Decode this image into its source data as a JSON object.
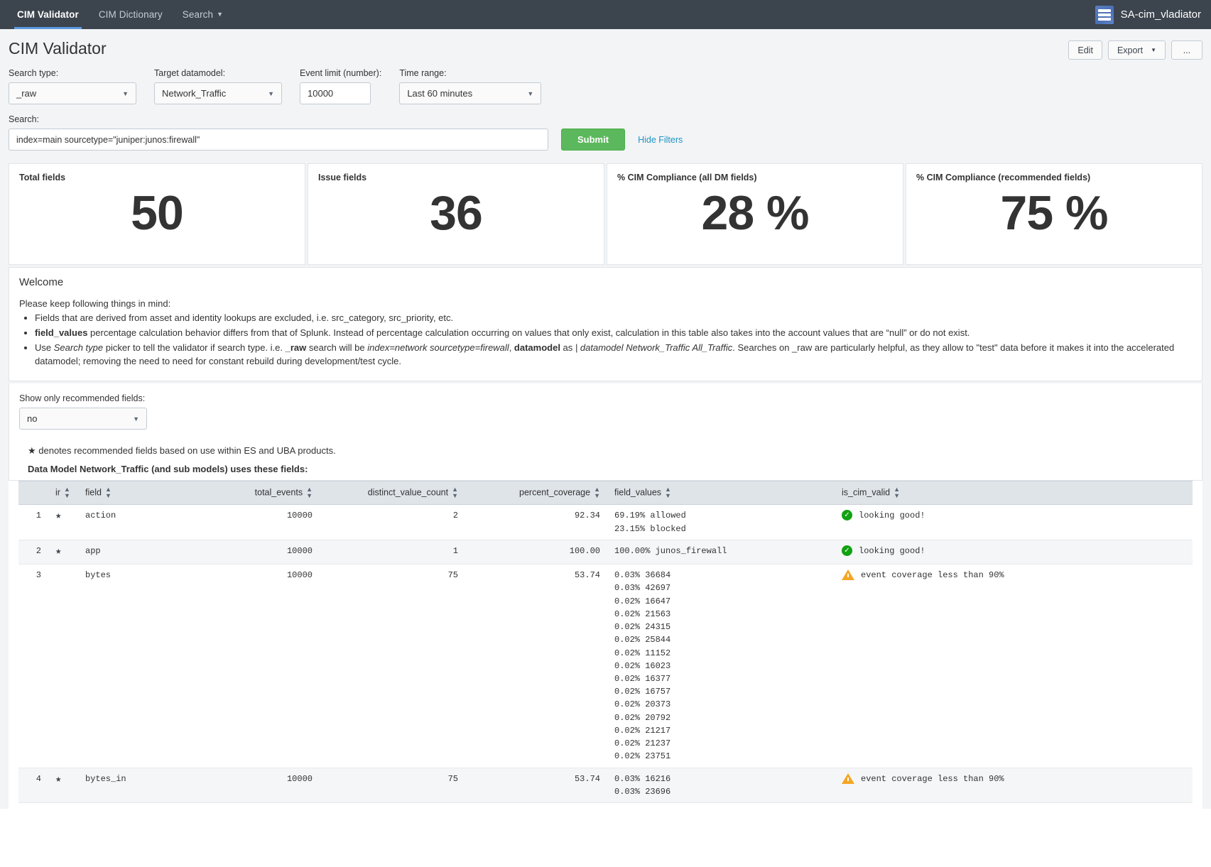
{
  "appbar": {
    "nav": [
      {
        "label": "CIM Validator",
        "active": true,
        "caret": false
      },
      {
        "label": "CIM Dictionary",
        "active": false,
        "caret": false
      },
      {
        "label": "Search",
        "active": false,
        "caret": true
      }
    ],
    "app_name": "SA-cim_vladiator",
    "logo_icon": "app-logo-icon"
  },
  "header": {
    "title": "CIM Validator",
    "edit_label": "Edit",
    "export_label": "Export",
    "more_label": "..."
  },
  "filters": {
    "search_type": {
      "label": "Search type:",
      "value": "_raw"
    },
    "target_datamodel": {
      "label": "Target datamodel:",
      "value": "Network_Traffic"
    },
    "event_limit": {
      "label": "Event limit (number):",
      "value": "10000"
    },
    "time_range": {
      "label": "Time range:",
      "value": "Last 60 minutes"
    }
  },
  "search": {
    "label": "Search:",
    "value": "index=main sourcetype=\"juniper:junos:firewall\"",
    "submit_label": "Submit",
    "hide_filters_label": "Hide Filters"
  },
  "kpis": [
    {
      "title": "Total fields",
      "value": "50"
    },
    {
      "title": "Issue fields",
      "value": "36"
    },
    {
      "title": "% CIM Compliance (all DM fields)",
      "value": "28 %"
    },
    {
      "title": "% CIM Compliance (recommended fields)",
      "value": "75 %"
    }
  ],
  "welcome": {
    "heading": "Welcome",
    "intro": "Please keep following things in mind:",
    "bullet1": "Fields that are derived from asset and identity lookups are excluded, i.e. src_category, src_priority, etc.",
    "bullet2_bold": "field_values",
    "bullet2_rest": " percentage calculation behavior differs from that of Splunk. Instead of percentage calculation occurring on values that only exist, calculation in this table also takes into the account values that are “null” or do not exist.",
    "bullet3_a": "Use ",
    "bullet3_i1": "Search type",
    "bullet3_b": " picker to tell the validator if search type. i.e. ",
    "bullet3_bold1": "_raw",
    "bullet3_c": " search will be ",
    "bullet3_i2": "index=network sourcetype=firewall",
    "bullet3_d": ", ",
    "bullet3_bold2": "datamodel",
    "bullet3_e": " as ",
    "bullet3_i3": "| datamodel Network_Traffic All_Traffic",
    "bullet3_f": ". Searches on _raw are particularly helpful, as they allow to \"test\" data before it makes it into the accelerated datamodel; removing the need to need for constant rebuild during development/test cycle."
  },
  "recommended_filter": {
    "label": "Show only recommended fields:",
    "value": "no"
  },
  "star_note": "★ denotes recommended fields based on use within ES and UBA products.",
  "table_title": "Data Model Network_Traffic (and sub models) uses these fields:",
  "table": {
    "columns": [
      {
        "key": "idx",
        "label": "",
        "align": "left",
        "sortable": false
      },
      {
        "key": "ir",
        "label": "ir",
        "align": "left",
        "sortable": true
      },
      {
        "key": "field",
        "label": "field",
        "align": "left",
        "sortable": true
      },
      {
        "key": "total_events",
        "label": "total_events",
        "align": "right",
        "sortable": true
      },
      {
        "key": "distinct_value_count",
        "label": "distinct_value_count",
        "align": "right",
        "sortable": true
      },
      {
        "key": "percent_coverage",
        "label": "percent_coverage",
        "align": "right",
        "sortable": true
      },
      {
        "key": "field_values",
        "label": "field_values",
        "align": "left",
        "sortable": true
      },
      {
        "key": "is_cim_valid",
        "label": "is_cim_valid",
        "align": "left",
        "sortable": true
      }
    ],
    "rows": [
      {
        "idx": "1",
        "ir": "★",
        "field": "action",
        "total_events": "10000",
        "distinct_value_count": "2",
        "percent_coverage": "92.34",
        "field_values": [
          "69.19% allowed",
          "23.15% blocked"
        ],
        "status_icon": "check-circle-icon",
        "is_cim_valid": "looking good!"
      },
      {
        "idx": "2",
        "ir": "★",
        "field": "app",
        "total_events": "10000",
        "distinct_value_count": "1",
        "percent_coverage": "100.00",
        "field_values": [
          "100.00% junos_firewall"
        ],
        "status_icon": "check-circle-icon",
        "is_cim_valid": "looking good!"
      },
      {
        "idx": "3",
        "ir": "",
        "field": "bytes",
        "total_events": "10000",
        "distinct_value_count": "75",
        "percent_coverage": "53.74",
        "field_values": [
          "0.03% 36684",
          "0.03% 42697",
          "0.02% 16647",
          "0.02% 21563",
          "0.02% 24315",
          "0.02% 25844",
          "0.02% 11152",
          "0.02% 16023",
          "0.02% 16377",
          "0.02% 16757",
          "0.02% 20373",
          "0.02% 20792",
          "0.02% 21217",
          "0.02% 21237",
          "0.02% 23751"
        ],
        "status_icon": "warning-triangle-icon",
        "is_cim_valid": "event coverage less than 90%"
      },
      {
        "idx": "4",
        "ir": "★",
        "field": "bytes_in",
        "total_events": "10000",
        "distinct_value_count": "75",
        "percent_coverage": "53.74",
        "field_values": [
          "0.03% 16216",
          "0.03% 23696"
        ],
        "status_icon": "warning-triangle-icon",
        "is_cim_valid": "event coverage less than 90%"
      }
    ]
  },
  "colors": {
    "navbar": "#3c444d",
    "accent_tab": "#5a9ae0",
    "submit_green": "#5cb85c",
    "link_blue": "#1e93c6",
    "ok_green": "#11a111",
    "warn_orange": "#f5a623"
  }
}
